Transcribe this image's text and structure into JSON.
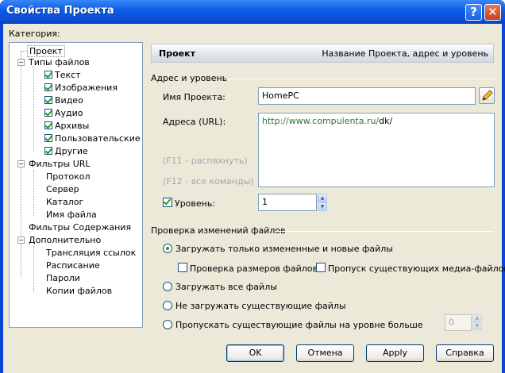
{
  "window": {
    "title": "Свойства Проекта",
    "help_glyph": "?",
    "close_glyph": "✕"
  },
  "category_label": "Категория:",
  "tree": {
    "project": "Проект",
    "file_types": "Типы файлов",
    "file_type_items": [
      {
        "label": "Текст",
        "checked": true
      },
      {
        "label": "Изображения",
        "checked": true
      },
      {
        "label": "Видео",
        "checked": true
      },
      {
        "label": "Аудио",
        "checked": true
      },
      {
        "label": "Архивы",
        "checked": true
      },
      {
        "label": "Пользовательские",
        "checked": true
      },
      {
        "label": "Другие",
        "checked": true
      }
    ],
    "url_filters": "Фильтры URL",
    "url_filter_items": [
      "Протокол",
      "Сервер",
      "Каталог",
      "Имя файла"
    ],
    "content_filters": "Фильтры Содержания",
    "advanced": "Дополнительно",
    "advanced_items": [
      "Трансляция ссылок",
      "Расписание",
      "Пароли",
      "Копии файлов"
    ]
  },
  "header": {
    "title": "Проект",
    "subtitle": "Название Проекта, адрес и уровень"
  },
  "address_group": {
    "title": "Адрес и уровень",
    "project_name_label": "Имя Проекта:",
    "project_name_value": "HomePC",
    "url_label": "Адреса (URL):",
    "url_value_prefix": "http://www.compulenta.ru/",
    "url_value_suffix": "dk/",
    "hint_f11": "(F11 - распахнуть)",
    "hint_f12": "(F12 - все команды)",
    "level_label": "Уровень:",
    "level_checked": true,
    "level_value": "1"
  },
  "check_group": {
    "title": "Проверка изменений файлов",
    "options": [
      "Загружать только измененные и новые файлы",
      "Загружать все файлы",
      "Не загружать существующие файлы",
      "Пропускать существующие файлы на уровне больше"
    ],
    "selected_index": 0,
    "check_sizes": "Проверка размеров файлов",
    "skip_media": "Пропуск существующих медиа-файлов",
    "skip_level_value": "0"
  },
  "buttons": {
    "ok": "OK",
    "cancel": "Отмена",
    "apply": "Apply",
    "help": "Справка"
  },
  "colors": {
    "title_bar": "#0a4ed5",
    "dialog_bg": "#ece9d8",
    "checkmark": "#21a121",
    "link_green": "#2b7a2b"
  }
}
